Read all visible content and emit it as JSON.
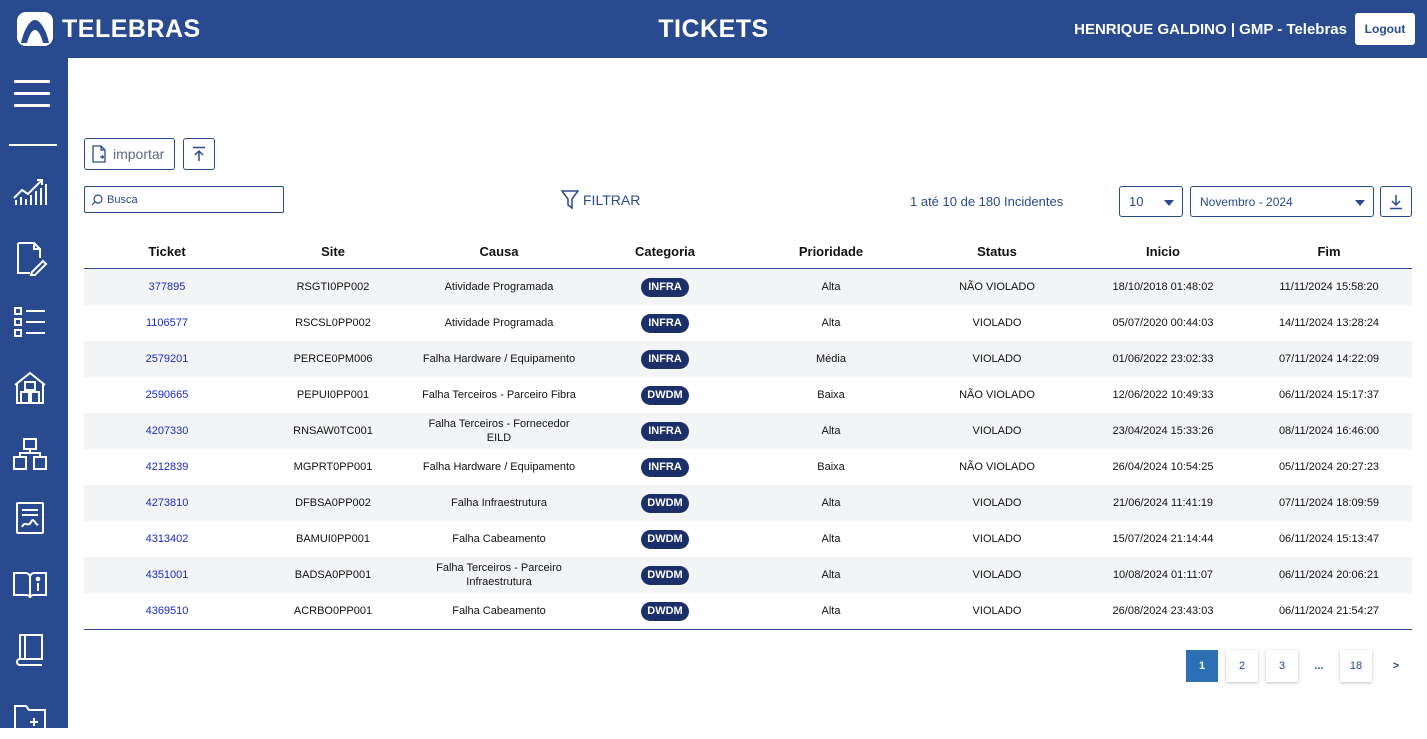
{
  "header": {
    "brand": "TELEBRAS",
    "title": "TICKETS",
    "user": "HENRIQUE GALDINO | GMP - Telebras",
    "logout_label": "Logout"
  },
  "colors": {
    "primary": "#294a8e",
    "badge": "#1b2f6b",
    "link": "#1a2bbf",
    "active_page": "#2d6fb4"
  },
  "sidebar": {
    "items": [
      {
        "icon": "menu-icon"
      },
      {
        "icon": "chart-icon"
      },
      {
        "icon": "document-edit-icon"
      },
      {
        "icon": "checklist-icon"
      },
      {
        "icon": "building-icon"
      },
      {
        "icon": "boxes-icon"
      },
      {
        "icon": "report-icon"
      },
      {
        "icon": "book-info-icon"
      },
      {
        "icon": "notebook-icon"
      },
      {
        "icon": "folder-icon"
      }
    ]
  },
  "toolbar": {
    "import_label": "importar",
    "search_placeholder": "Busca",
    "filter_label": "FILTRAR",
    "records_info": "1 até 10 de 180 Incidentes",
    "per_page": "10",
    "month": "Novembro - 2024"
  },
  "table": {
    "columns": [
      "Ticket",
      "Site",
      "Causa",
      "Categoria",
      "Prioridade",
      "Status",
      "Inicio",
      "Fim"
    ],
    "rows": [
      {
        "ticket": "377895",
        "site": "RSGTI0PP002",
        "causa": "Atividade Programada",
        "categoria": "INFRA",
        "prioridade": "Alta",
        "status": "NÃO VIOLADO",
        "inicio": "18/10/2018 01:48:02",
        "fim": "11/11/2024 15:58:20"
      },
      {
        "ticket": "1106577",
        "site": "RSCSL0PP002",
        "causa": "Atividade Programada",
        "categoria": "INFRA",
        "prioridade": "Alta",
        "status": "VIOLADO",
        "inicio": "05/07/2020 00:44:03",
        "fim": "14/11/2024 13:28:24"
      },
      {
        "ticket": "2579201",
        "site": "PERCE0PM006",
        "causa": "Falha Hardware / Equipamento",
        "categoria": "INFRA",
        "prioridade": "Média",
        "status": "VIOLADO",
        "inicio": "01/06/2022 23:02:33",
        "fim": "07/11/2024 14:22:09"
      },
      {
        "ticket": "2590665",
        "site": "PEPUI0PP001",
        "causa": "Falha Terceiros - Parceiro Fibra",
        "categoria": "DWDM",
        "prioridade": "Baixa",
        "status": "NÃO VIOLADO",
        "inicio": "12/06/2022 10:49:33",
        "fim": "06/11/2024 15:17:37"
      },
      {
        "ticket": "4207330",
        "site": "RNSAW0TC001",
        "causa": "Falha Terceiros - Fornecedor EILD",
        "categoria": "INFRA",
        "prioridade": "Alta",
        "status": "VIOLADO",
        "inicio": "23/04/2024 15:33:26",
        "fim": "08/11/2024 16:46:00"
      },
      {
        "ticket": "4212839",
        "site": "MGPRT0PP001",
        "causa": "Falha Hardware / Equipamento",
        "categoria": "INFRA",
        "prioridade": "Baixa",
        "status": "NÃO VIOLADO",
        "inicio": "26/04/2024 10:54:25",
        "fim": "05/11/2024 20:27:23"
      },
      {
        "ticket": "4273810",
        "site": "DFBSA0PP002",
        "causa": "Falha Infraestrutura",
        "categoria": "DWDM",
        "prioridade": "Alta",
        "status": "VIOLADO",
        "inicio": "21/06/2024 11:41:19",
        "fim": "07/11/2024 18:09:59"
      },
      {
        "ticket": "4313402",
        "site": "BAMUI0PP001",
        "causa": "Falha Cabeamento",
        "categoria": "DWDM",
        "prioridade": "Alta",
        "status": "VIOLADO",
        "inicio": "15/07/2024 21:14:44",
        "fim": "06/11/2024 15:13:47"
      },
      {
        "ticket": "4351001",
        "site": "BADSA0PP001",
        "causa": "Falha Terceiros - Parceiro Infraestrutura",
        "categoria": "DWDM",
        "prioridade": "Alta",
        "status": "VIOLADO",
        "inicio": "10/08/2024 01:11:07",
        "fim": "06/11/2024 20:06:21"
      },
      {
        "ticket": "4369510",
        "site": "ACRBO0PP001",
        "causa": "Falha Cabeamento",
        "categoria": "DWDM",
        "prioridade": "Alta",
        "status": "VIOLADO",
        "inicio": "26/08/2024 23:43:03",
        "fim": "06/11/2024 21:54:27"
      }
    ]
  },
  "pagination": {
    "pages": [
      "1",
      "2",
      "3",
      "...",
      "18"
    ],
    "active": "1",
    "next": ">"
  }
}
